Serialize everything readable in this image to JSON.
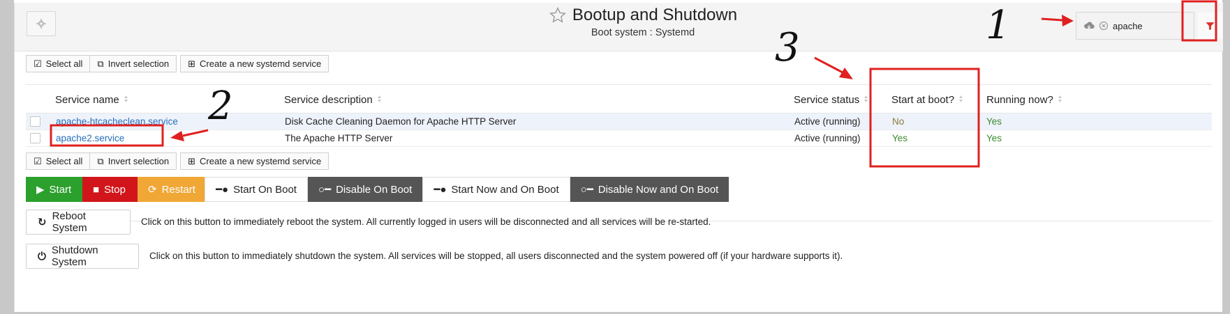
{
  "header": {
    "title": "Bootup and Shutdown",
    "subtitle": "Boot system : Systemd",
    "search_value": "apache"
  },
  "toolbar": {
    "select_all": "Select all",
    "invert_selection": "Invert selection",
    "create_service": "Create a new systemd service"
  },
  "table": {
    "columns": {
      "name": "Service name",
      "description": "Service description",
      "status": "Service status",
      "boot": "Start at boot?",
      "running": "Running now?"
    },
    "rows": [
      {
        "name": "apache-htcacheclean.service",
        "description": "Disk Cache Cleaning Daemon for Apache HTTP Server",
        "status": "Active (running)",
        "boot": "No",
        "running": "Yes"
      },
      {
        "name": "apache2.service",
        "description": "The Apache HTTP Server",
        "status": "Active (running)",
        "boot": "Yes",
        "running": "Yes"
      }
    ]
  },
  "actions": {
    "start": "Start",
    "stop": "Stop",
    "restart": "Restart",
    "start_on_boot": "Start On Boot",
    "disable_on_boot": "Disable On Boot",
    "start_now_and_on_boot": "Start Now and On Boot",
    "disable_now_and_on_boot": "Disable Now and On Boot"
  },
  "system": {
    "reboot_label": "Reboot System",
    "reboot_text": "Click on this button to immediately reboot the system. All currently logged in users will be disconnected and all services will be re-started.",
    "shutdown_label": "Shutdown System",
    "shutdown_text": "Click on this button to immediately shutdown the system. All services will be stopped, all users disconnected and the system powered off (if your hardware supports it)."
  },
  "annotations": {
    "mark_1": "1",
    "mark_2": "2",
    "mark_3": "3",
    "color": "#e02020"
  },
  "colors": {
    "start": "#2ca02c",
    "stop": "#d1151b",
    "restart": "#f0a736",
    "dark_button": "#555555",
    "link": "#2a6ebb"
  }
}
